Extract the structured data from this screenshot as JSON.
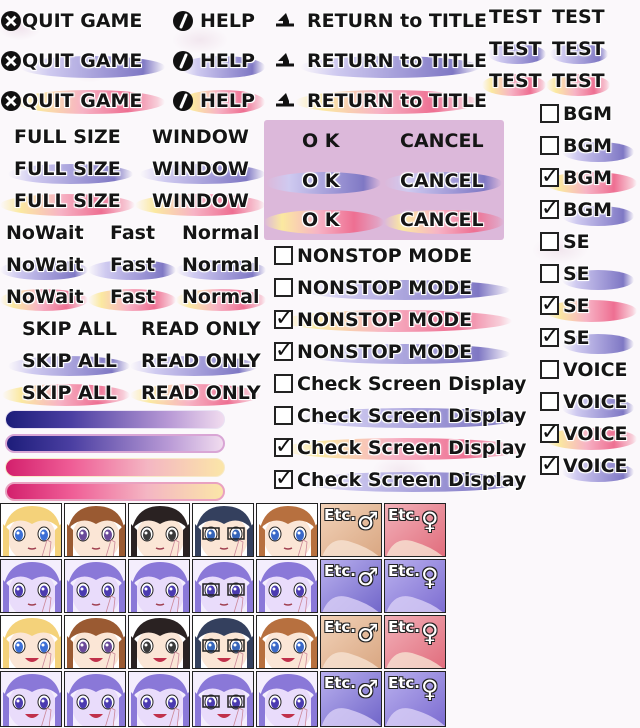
{
  "menu": {
    "quit_label": "QUIT GAME",
    "help_label": "HELP",
    "return_label": "RETURN to TITLE"
  },
  "test": {
    "label": "TEST"
  },
  "window_mode": {
    "full_label": "FULL SIZE",
    "window_label": "WINDOW"
  },
  "dialog": {
    "ok_label": "O K",
    "cancel_label": "CANCEL"
  },
  "speed": {
    "nowait_label": "NoWait",
    "fast_label": "Fast",
    "normal_label": "Normal"
  },
  "skip": {
    "skip_all_label": "SKIP ALL",
    "read_only_label": "READ ONLY"
  },
  "options": {
    "nonstop_label": "NONSTOP MODE",
    "check_screen_label": "Check Screen Display"
  },
  "audio": {
    "bgm_label": "BGM",
    "se_label": "SE",
    "voice_label": "VOICE"
  },
  "faces": {
    "etc_label": "Etc.",
    "male_symbol": "♂",
    "female_symbol": "♀"
  },
  "colors": {
    "panel_bg": "#dcb8da",
    "accent_purple": "#8d86c8",
    "accent_pink": "#f07090",
    "accent_yellow": "#fbe9a0"
  }
}
